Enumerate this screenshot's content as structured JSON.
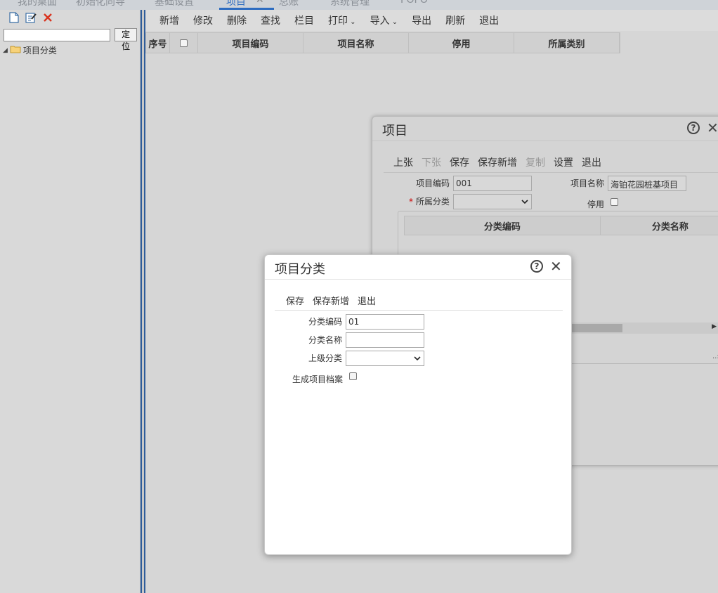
{
  "top_tabs": [
    "我的桌面",
    "初始化向导",
    "基础设置",
    "项目",
    "总账",
    "系统管理",
    "POPO"
  ],
  "left": {
    "locate_label": "定位",
    "search_value": "",
    "tree_root": "项目分类"
  },
  "main": {
    "toolbar": [
      "新增",
      "修改",
      "删除",
      "查找",
      "栏目",
      "打印",
      "导入",
      "导出",
      "刷新",
      "退出"
    ],
    "dropdown_items": [
      "打印",
      "导入"
    ],
    "grid_headers": {
      "seq": "序号",
      "code": "项目编码",
      "name": "项目名称",
      "disabled": "停用",
      "category": "所属类别"
    }
  },
  "project_dialog": {
    "title": "项目",
    "toolbar": {
      "prev": "上张",
      "next": "下张",
      "save": "保存",
      "save_new": "保存新增",
      "copy": "复制",
      "settings": "设置",
      "exit": "退出"
    },
    "code_label": "项目编码",
    "code_value": "001",
    "name_label": "项目名称",
    "name_value": "海铂花园桩基项目",
    "category_required": "*",
    "category_label": "所属分类",
    "disabled_label": "停用",
    "sub_grid_headers": [
      "分类编码",
      "分类名称"
    ]
  },
  "category_dialog": {
    "title": "项目分类",
    "toolbar": {
      "save": "保存",
      "save_new": "保存新增",
      "exit": "退出"
    },
    "code_label": "分类编码",
    "code_value": "01",
    "name_label": "分类名称",
    "name_value": "",
    "parent_label": "上级分类",
    "generate_label": "生成项目档案"
  }
}
